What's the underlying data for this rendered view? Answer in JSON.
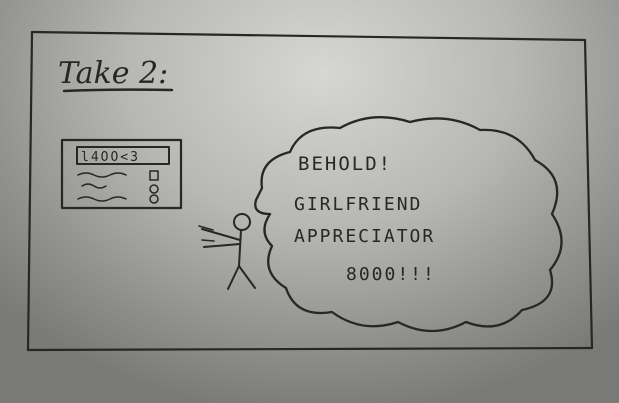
{
  "title": "Take 2:",
  "device": {
    "screen_text": "l4OO<3"
  },
  "speech": {
    "line1": "BEHOLD!",
    "line2": "GIRLFRIEND",
    "line3": "APPRECIATOR",
    "line4": "8000!!!"
  }
}
